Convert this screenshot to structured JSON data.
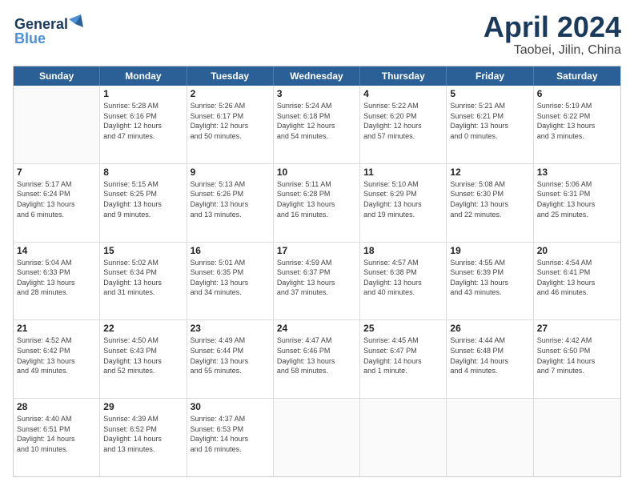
{
  "header": {
    "logo_line1": "General",
    "logo_line2": "Blue",
    "month_year": "April 2024",
    "location": "Taobei, Jilin, China"
  },
  "days_of_week": [
    "Sunday",
    "Monday",
    "Tuesday",
    "Wednesday",
    "Thursday",
    "Friday",
    "Saturday"
  ],
  "weeks": [
    [
      {
        "day": "",
        "info": ""
      },
      {
        "day": "1",
        "info": "Sunrise: 5:28 AM\nSunset: 6:16 PM\nDaylight: 12 hours\nand 47 minutes."
      },
      {
        "day": "2",
        "info": "Sunrise: 5:26 AM\nSunset: 6:17 PM\nDaylight: 12 hours\nand 50 minutes."
      },
      {
        "day": "3",
        "info": "Sunrise: 5:24 AM\nSunset: 6:18 PM\nDaylight: 12 hours\nand 54 minutes."
      },
      {
        "day": "4",
        "info": "Sunrise: 5:22 AM\nSunset: 6:20 PM\nDaylight: 12 hours\nand 57 minutes."
      },
      {
        "day": "5",
        "info": "Sunrise: 5:21 AM\nSunset: 6:21 PM\nDaylight: 13 hours\nand 0 minutes."
      },
      {
        "day": "6",
        "info": "Sunrise: 5:19 AM\nSunset: 6:22 PM\nDaylight: 13 hours\nand 3 minutes."
      }
    ],
    [
      {
        "day": "7",
        "info": "Sunrise: 5:17 AM\nSunset: 6:24 PM\nDaylight: 13 hours\nand 6 minutes."
      },
      {
        "day": "8",
        "info": "Sunrise: 5:15 AM\nSunset: 6:25 PM\nDaylight: 13 hours\nand 9 minutes."
      },
      {
        "day": "9",
        "info": "Sunrise: 5:13 AM\nSunset: 6:26 PM\nDaylight: 13 hours\nand 13 minutes."
      },
      {
        "day": "10",
        "info": "Sunrise: 5:11 AM\nSunset: 6:28 PM\nDaylight: 13 hours\nand 16 minutes."
      },
      {
        "day": "11",
        "info": "Sunrise: 5:10 AM\nSunset: 6:29 PM\nDaylight: 13 hours\nand 19 minutes."
      },
      {
        "day": "12",
        "info": "Sunrise: 5:08 AM\nSunset: 6:30 PM\nDaylight: 13 hours\nand 22 minutes."
      },
      {
        "day": "13",
        "info": "Sunrise: 5:06 AM\nSunset: 6:31 PM\nDaylight: 13 hours\nand 25 minutes."
      }
    ],
    [
      {
        "day": "14",
        "info": "Sunrise: 5:04 AM\nSunset: 6:33 PM\nDaylight: 13 hours\nand 28 minutes."
      },
      {
        "day": "15",
        "info": "Sunrise: 5:02 AM\nSunset: 6:34 PM\nDaylight: 13 hours\nand 31 minutes."
      },
      {
        "day": "16",
        "info": "Sunrise: 5:01 AM\nSunset: 6:35 PM\nDaylight: 13 hours\nand 34 minutes."
      },
      {
        "day": "17",
        "info": "Sunrise: 4:59 AM\nSunset: 6:37 PM\nDaylight: 13 hours\nand 37 minutes."
      },
      {
        "day": "18",
        "info": "Sunrise: 4:57 AM\nSunset: 6:38 PM\nDaylight: 13 hours\nand 40 minutes."
      },
      {
        "day": "19",
        "info": "Sunrise: 4:55 AM\nSunset: 6:39 PM\nDaylight: 13 hours\nand 43 minutes."
      },
      {
        "day": "20",
        "info": "Sunrise: 4:54 AM\nSunset: 6:41 PM\nDaylight: 13 hours\nand 46 minutes."
      }
    ],
    [
      {
        "day": "21",
        "info": "Sunrise: 4:52 AM\nSunset: 6:42 PM\nDaylight: 13 hours\nand 49 minutes."
      },
      {
        "day": "22",
        "info": "Sunrise: 4:50 AM\nSunset: 6:43 PM\nDaylight: 13 hours\nand 52 minutes."
      },
      {
        "day": "23",
        "info": "Sunrise: 4:49 AM\nSunset: 6:44 PM\nDaylight: 13 hours\nand 55 minutes."
      },
      {
        "day": "24",
        "info": "Sunrise: 4:47 AM\nSunset: 6:46 PM\nDaylight: 13 hours\nand 58 minutes."
      },
      {
        "day": "25",
        "info": "Sunrise: 4:45 AM\nSunset: 6:47 PM\nDaylight: 14 hours\nand 1 minute."
      },
      {
        "day": "26",
        "info": "Sunrise: 4:44 AM\nSunset: 6:48 PM\nDaylight: 14 hours\nand 4 minutes."
      },
      {
        "day": "27",
        "info": "Sunrise: 4:42 AM\nSunset: 6:50 PM\nDaylight: 14 hours\nand 7 minutes."
      }
    ],
    [
      {
        "day": "28",
        "info": "Sunrise: 4:40 AM\nSunset: 6:51 PM\nDaylight: 14 hours\nand 10 minutes."
      },
      {
        "day": "29",
        "info": "Sunrise: 4:39 AM\nSunset: 6:52 PM\nDaylight: 14 hours\nand 13 minutes."
      },
      {
        "day": "30",
        "info": "Sunrise: 4:37 AM\nSunset: 6:53 PM\nDaylight: 14 hours\nand 16 minutes."
      },
      {
        "day": "",
        "info": ""
      },
      {
        "day": "",
        "info": ""
      },
      {
        "day": "",
        "info": ""
      },
      {
        "day": "",
        "info": ""
      }
    ]
  ]
}
